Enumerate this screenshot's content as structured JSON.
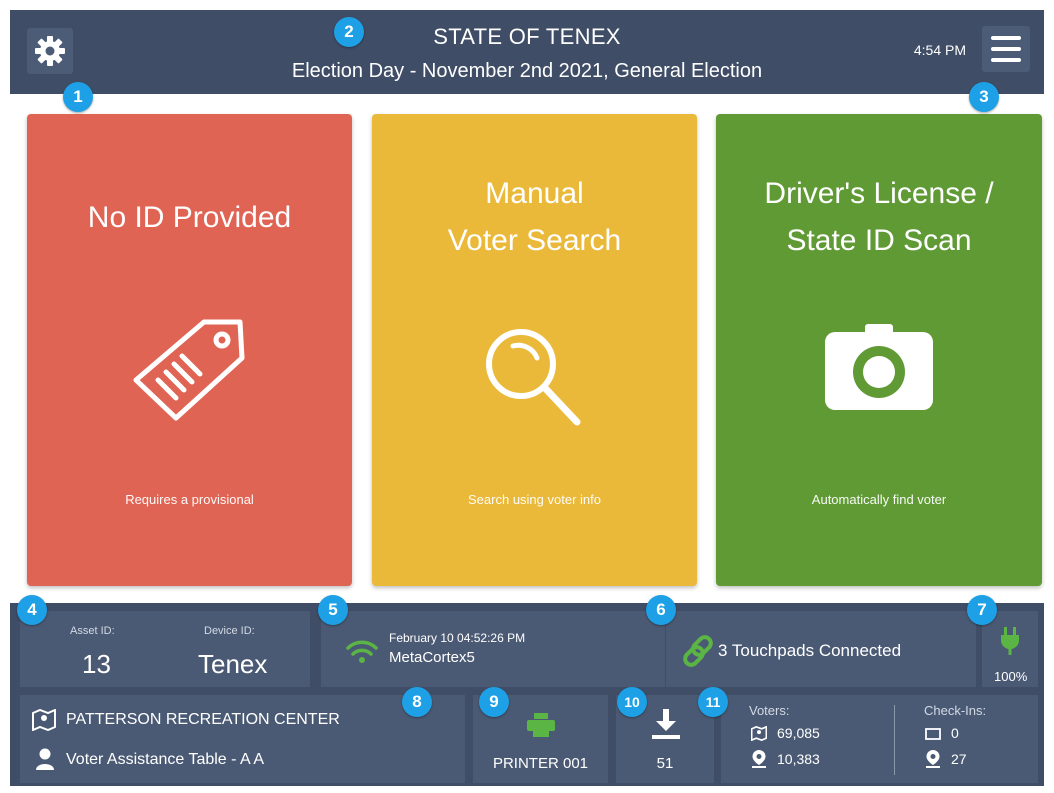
{
  "header": {
    "title": "STATE OF TENEX",
    "subtitle": "Election Day - November 2nd 2021, General Election",
    "time": "4:54 PM"
  },
  "cards": [
    {
      "title_line1": "No ID Provided",
      "title_line2": "",
      "subtitle": "Requires a provisional",
      "color": "#e06454",
      "icon": "tag-icon"
    },
    {
      "title_line1": "Manual",
      "title_line2": "Voter Search",
      "subtitle": "Search using voter info",
      "color": "#ebb93a",
      "icon": "magnifier-icon"
    },
    {
      "title_line1": "Driver's License /",
      "title_line2": "State ID Scan",
      "subtitle": "Automatically find voter",
      "color": "#5f9a35",
      "icon": "camera-icon"
    }
  ],
  "status": {
    "asset_label": "Asset ID:",
    "asset_value": "13",
    "device_label": "Device ID:",
    "device_value": "Tenex",
    "network_datetime": "February 10  04:52:26 PM",
    "network_name": "MetaCortex5",
    "touchpads": "3 Touchpads Connected",
    "battery": "100%"
  },
  "location": {
    "name": "PATTERSON RECREATION CENTER",
    "table": "Voter Assistance Table - A A"
  },
  "printer": {
    "label": "PRINTER 001"
  },
  "downloads": {
    "count": "51"
  },
  "stats": {
    "voters_label": "Voters:",
    "voters_precinct": "69,085",
    "voters_location": "10,383",
    "checkins_label": "Check-Ins:",
    "checkins_device": "0",
    "checkins_location": "27"
  },
  "badges": [
    "1",
    "2",
    "3",
    "4",
    "5",
    "6",
    "7",
    "8",
    "9",
    "10",
    "11"
  ],
  "colors": {
    "header": "#3f4d66",
    "tile": "#4b5a74",
    "accent_green": "#5bb544",
    "badge": "#1ea0e6"
  }
}
